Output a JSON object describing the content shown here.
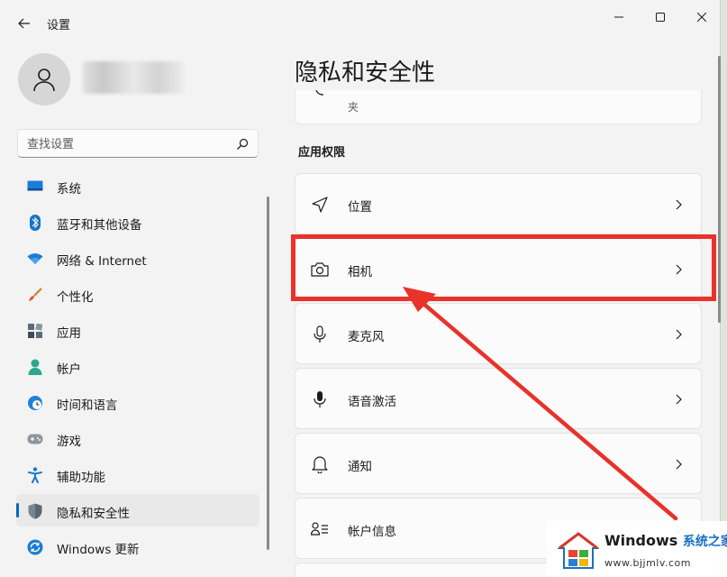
{
  "window": {
    "title": "设置"
  },
  "search": {
    "placeholder": "查找设置"
  },
  "nav": {
    "items": [
      {
        "label": "系统",
        "icon": "display-icon",
        "active": false
      },
      {
        "label": "蓝牙和其他设备",
        "icon": "bluetooth-icon",
        "active": false
      },
      {
        "label": "网络 & Internet",
        "icon": "wifi-icon",
        "active": false
      },
      {
        "label": "个性化",
        "icon": "brush-icon",
        "active": false
      },
      {
        "label": "应用",
        "icon": "apps-icon",
        "active": false
      },
      {
        "label": "帐户",
        "icon": "person-icon",
        "active": false
      },
      {
        "label": "时间和语言",
        "icon": "globe-clock-icon",
        "active": false
      },
      {
        "label": "游戏",
        "icon": "gamepad-icon",
        "active": false
      },
      {
        "label": "辅助功能",
        "icon": "accessibility-icon",
        "active": false
      },
      {
        "label": "隐私和安全性",
        "icon": "shield-icon",
        "active": true
      },
      {
        "label": "Windows 更新",
        "icon": "update-icon",
        "active": false
      }
    ]
  },
  "main": {
    "title": "隐私和安全性",
    "top_card_text": "夹",
    "section_heading": "应用权限",
    "permissions": [
      {
        "label": "位置",
        "icon": "location-icon"
      },
      {
        "label": "相机",
        "icon": "camera-icon",
        "highlighted": true
      },
      {
        "label": "麦克风",
        "icon": "microphone-icon"
      },
      {
        "label": "语音激活",
        "icon": "voice-activation-icon"
      },
      {
        "label": "通知",
        "icon": "bell-icon"
      },
      {
        "label": "帐户信息",
        "icon": "account-info-icon"
      }
    ]
  },
  "watermark": {
    "title": "Windows",
    "title_accent": "系统之家",
    "url": "www.bjjmlv.com"
  },
  "colors": {
    "accent": "#0067c0",
    "annotation": "#e8322a"
  }
}
